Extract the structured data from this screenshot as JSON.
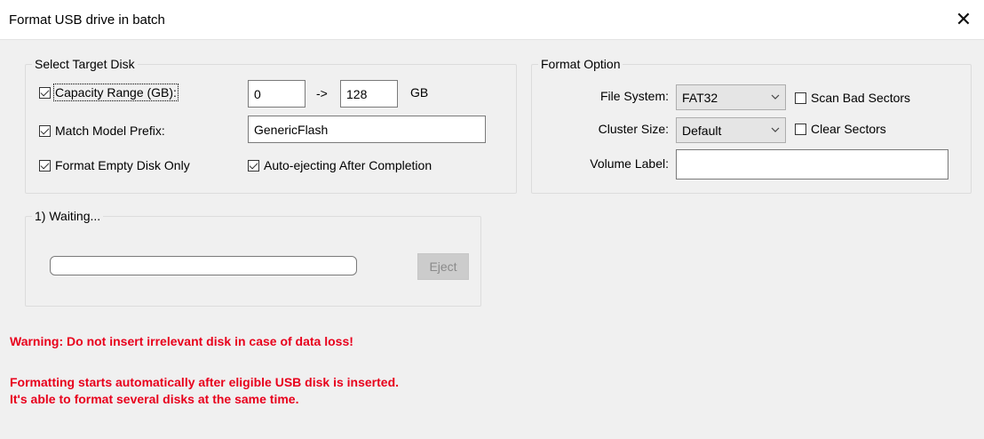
{
  "window": {
    "title": "Format USB drive in batch"
  },
  "target": {
    "legend": "Select Target Disk",
    "capacity_label": "Capacity Range (GB):",
    "capacity_checked": true,
    "capacity_min": "0",
    "arrow": "->",
    "capacity_max": "128",
    "unit": "GB",
    "model_label": "Match Model Prefix:",
    "model_checked": true,
    "model_value": "GenericFlash",
    "empty_only_label": "Format Empty Disk Only",
    "empty_only_checked": true,
    "auto_eject_label": "Auto-ejecting After Completion",
    "auto_eject_checked": true
  },
  "format": {
    "legend": "Format Option",
    "fs_label": "File System:",
    "fs_value": "FAT32",
    "scan_label": "Scan Bad Sectors",
    "scan_checked": false,
    "cluster_label": "Cluster Size:",
    "cluster_value": "Default",
    "clear_label": "Clear Sectors",
    "clear_checked": false,
    "volume_label": "Volume Label:",
    "volume_value": ""
  },
  "slot": {
    "legend": "1) Waiting...",
    "progress": 0,
    "eject_label": "Eject"
  },
  "warnings": {
    "line1": "Warning: Do not insert irrelevant disk in case of data loss!",
    "line2": "Formatting starts automatically after eligible USB disk is inserted.",
    "line3": "It's able to format several disks at the same time."
  },
  "colors": {
    "warning": "#e8001c",
    "progress_fill": "#06b025"
  }
}
